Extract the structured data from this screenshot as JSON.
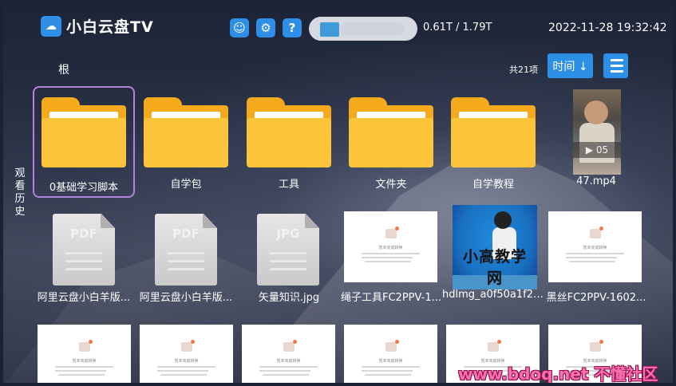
{
  "header": {
    "app_title": "小白云盘TV",
    "storage": "0.61T / 1.79T",
    "datetime": "2022-11-28 19:32:42"
  },
  "toolbar": {
    "breadcrumb": "根",
    "item_count": "共21项",
    "sort_label": "时间 ↓"
  },
  "sidebar": {
    "history_label": "观看历史"
  },
  "row1": [
    {
      "label": "0基础学习脚本",
      "kind": "folder"
    },
    {
      "label": "自学包",
      "kind": "folder"
    },
    {
      "label": "工具",
      "kind": "folder"
    },
    {
      "label": "文件夹",
      "kind": "folder"
    },
    {
      "label": "自学教程",
      "kind": "folder"
    },
    {
      "label": "47.mp4",
      "kind": "video",
      "duration": "05"
    }
  ],
  "row2": [
    {
      "label": "阿里云盘小白羊版...",
      "kind": "pdf",
      "tag": "PDF"
    },
    {
      "label": "阿里云盘小白羊版...",
      "kind": "pdf",
      "tag": "PDF"
    },
    {
      "label": "矢量知识.jpg",
      "kind": "jpg",
      "tag": "JPG"
    },
    {
      "label": "绳子工具FC2PPV-1...",
      "kind": "preview"
    },
    {
      "label": "hdlmg_a0f50a1f22...",
      "kind": "image",
      "image_text": "小高教学网"
    },
    {
      "label": "黑丝FC2PPV-1602...",
      "kind": "preview"
    }
  ],
  "watermark": "www.bdoq.net 不懂社区",
  "preview_caption": "暂未完成转换"
}
